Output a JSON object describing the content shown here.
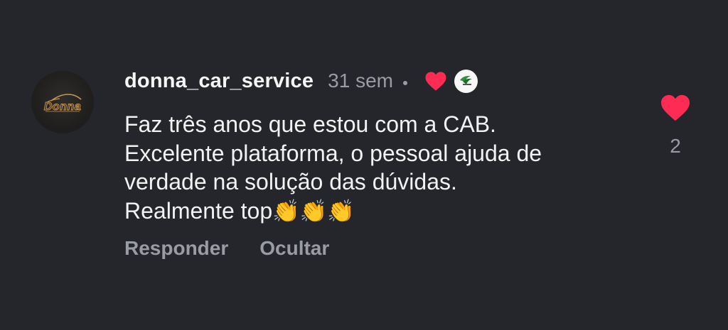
{
  "comment": {
    "avatar": {
      "logo_text": "Donna",
      "icon": "donna-car-logo-icon"
    },
    "username": "donna_car_service",
    "time": "31 sem",
    "creator_heart_icon": "heart-icon",
    "creator_badge_icon": "creator-avatar-icon",
    "text_lines": [
      "Faz três anos que estou com a CAB.",
      "Excelente plataforma, o pessoal ajuda de",
      "verdade na solução das dúvidas.",
      "Realmente top"
    ],
    "clap_emojis": [
      "👏",
      "👏",
      "👏"
    ],
    "actions": {
      "reply_label": "Responder",
      "hide_label": "Ocultar"
    },
    "like": {
      "icon": "heart-icon",
      "count": "2",
      "liked": true
    },
    "colors": {
      "background": "#25262b",
      "primary_text": "#f2f2f2",
      "secondary_text": "#9a9ca3",
      "heart": "#fe2c55",
      "logo_gold": "#c9964f"
    }
  }
}
